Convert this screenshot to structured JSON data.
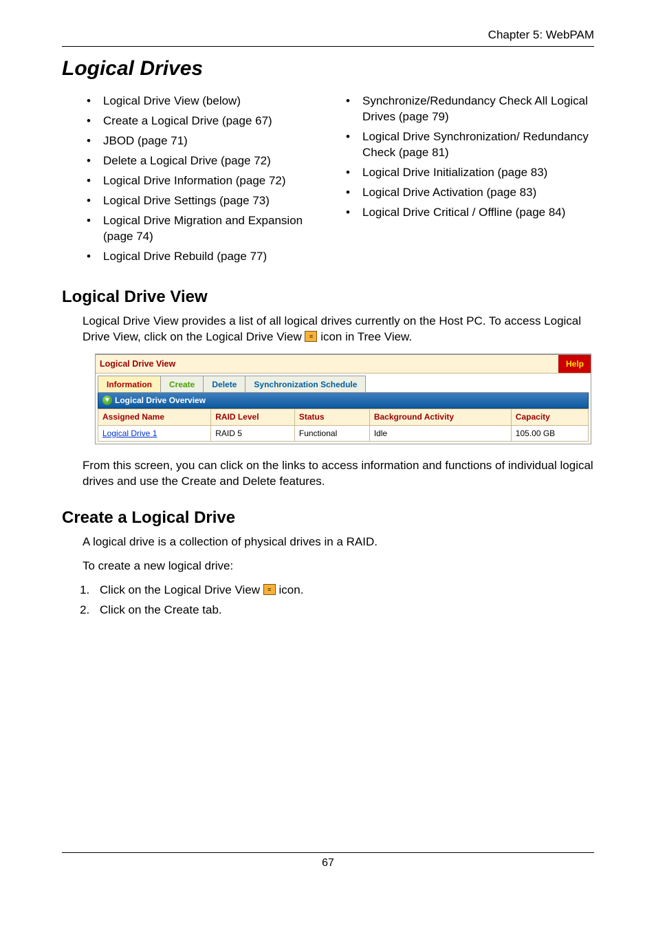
{
  "header": {
    "chapter": "Chapter 5: WebPAM"
  },
  "title": "Logical Drives",
  "toc": {
    "left": [
      "Logical Drive View (below)",
      "Create a Logical Drive (page 67)",
      "JBOD (page 71)",
      "Delete a Logical Drive (page 72)",
      "Logical Drive Information (page 72)",
      "Logical Drive Settings (page 73)",
      "Logical Drive Migration and Expansion (page 74)",
      "Logical Drive Rebuild (page 77)"
    ],
    "right": [
      "Synchronize/Redundancy Check All Logical Drives (page 79)",
      "Logical Drive Synchronization/ Redundancy Check (page 81)",
      "Logical Drive Initialization (page 83)",
      "Logical Drive Activation (page 83)",
      "Logical Drive Critical / Offline (page 84)"
    ]
  },
  "sections": {
    "ldv": {
      "title": "Logical Drive View",
      "p1a": "Logical Drive View provides a list of all logical drives currently on the Host PC. To access Logical Drive View, click on the Logical Drive View ",
      "p1b": " icon in Tree View.",
      "p2": "From this screen, you can click on the links to access information and functions of individual logical drives and use the Create and Delete features."
    },
    "create": {
      "title": "Create a Logical Drive",
      "intro1": "A logical drive is a collection of physical drives in a RAID.",
      "intro2": "To create a new logical drive:",
      "step1a": "Click on the Logical Drive View ",
      "step1b": " icon.",
      "step2": "Click on the Create tab."
    }
  },
  "screenshot": {
    "panel_title": "Logical Drive View",
    "help": "Help",
    "tabs": {
      "info": "Information",
      "create": "Create",
      "delete": "Delete",
      "sync": "Synchronization Schedule"
    },
    "overview_text": "Logical Drive Overview",
    "headers": {
      "name": "Assigned Name",
      "raid": "RAID Level",
      "status": "Status",
      "activity": "Background Activity",
      "capacity": "Capacity"
    },
    "row": {
      "name": "Logical Drive 1",
      "raid": "RAID 5",
      "status": "Functional",
      "activity": "Idle",
      "capacity": "105.00 GB"
    }
  },
  "footer": {
    "page": "67"
  },
  "chart_data": {
    "type": "table",
    "title": "Logical Drive Overview",
    "columns": [
      "Assigned Name",
      "RAID Level",
      "Status",
      "Background Activity",
      "Capacity"
    ],
    "rows": [
      [
        "Logical Drive 1",
        "RAID 5",
        "Functional",
        "Idle",
        "105.00 GB"
      ]
    ]
  }
}
